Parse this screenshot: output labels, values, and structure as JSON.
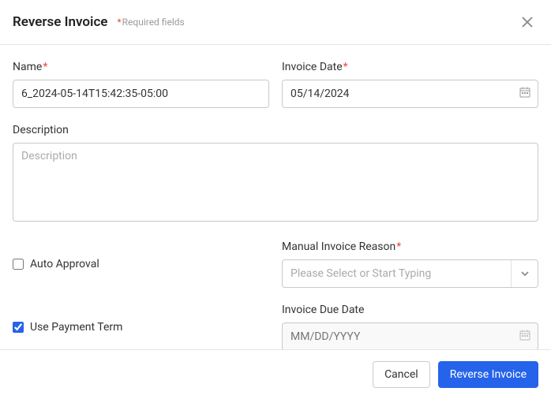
{
  "header": {
    "title": "Reverse Invoice",
    "required_hint": "Required fields"
  },
  "fields": {
    "name": {
      "label": "Name",
      "value": "6_2024-05-14T15:42:35-05:00"
    },
    "invoice_date": {
      "label": "Invoice Date",
      "value": "05/14/2024"
    },
    "description": {
      "label": "Description",
      "placeholder": "Description",
      "value": ""
    },
    "auto_approval": {
      "label": "Auto Approval",
      "checked": false
    },
    "manual_reason": {
      "label": "Manual Invoice Reason",
      "placeholder": "Please Select or Start Typing"
    },
    "use_payment_term": {
      "label": "Use Payment Term",
      "checked": true
    },
    "invoice_due_date": {
      "label": "Invoice Due Date",
      "placeholder": "MM/DD/YYYY"
    }
  },
  "footer": {
    "cancel": "Cancel",
    "submit": "Reverse Invoice"
  }
}
